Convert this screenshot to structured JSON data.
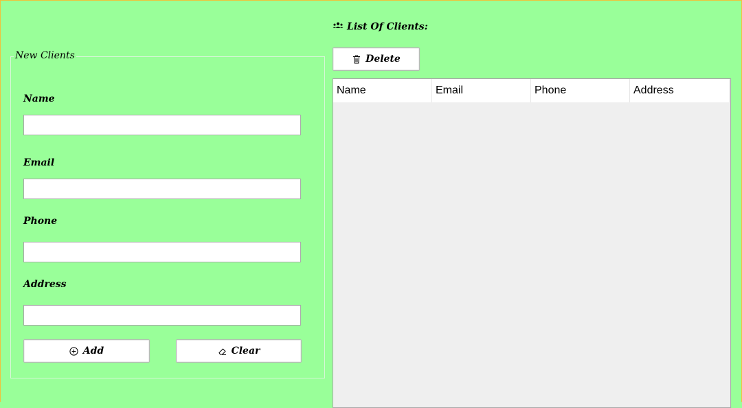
{
  "new_clients": {
    "title": "New Clients",
    "fields": [
      {
        "label": "Name",
        "value": "",
        "placeholder": ""
      },
      {
        "label": "Email",
        "value": "",
        "placeholder": ""
      },
      {
        "label": "Phone",
        "value": "",
        "placeholder": ""
      },
      {
        "label": "Address",
        "value": "",
        "placeholder": ""
      }
    ],
    "add_label": "Add",
    "clear_label": "Clear"
  },
  "clients_list": {
    "title": "List Of Clients:",
    "delete_label": "Delete",
    "columns": [
      "Name",
      "Email",
      "Phone",
      "Address"
    ],
    "rows": []
  },
  "icons": {
    "list_title": "users-icon",
    "delete": "trash-icon",
    "add": "plus-circle-icon",
    "clear": "eraser-icon"
  },
  "colors": {
    "background": "#99ff99",
    "window_border": "#f0c23a",
    "input_background": "#ffffff",
    "table_background": "#efefef"
  }
}
